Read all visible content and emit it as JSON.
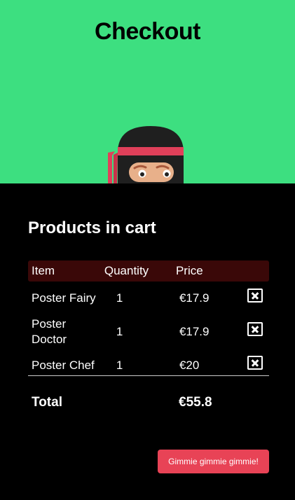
{
  "header": {
    "title": "Checkout",
    "background_color": "#3ddf80",
    "mascot_icon": "ninja-mascot"
  },
  "cart": {
    "title": "Products in cart",
    "columns": {
      "item": "Item",
      "quantity": "Quantity",
      "price": "Price"
    },
    "items": [
      {
        "name": "Poster Fairy",
        "quantity": "1",
        "price": "€17.9",
        "remove_icon": "remove-x-icon"
      },
      {
        "name": "Poster Doctor",
        "quantity": "1",
        "price": "€17.9",
        "remove_icon": "remove-x-icon"
      },
      {
        "name": "Poster Chef",
        "quantity": "1",
        "price": "€20",
        "remove_icon": "remove-x-icon"
      }
    ],
    "total_label": "Total",
    "total_value": "€55.8",
    "header_row_color": "#3a0808"
  },
  "actions": {
    "checkout_label": "Gimmie gimmie gimmie!",
    "checkout_color": "#e84356"
  }
}
